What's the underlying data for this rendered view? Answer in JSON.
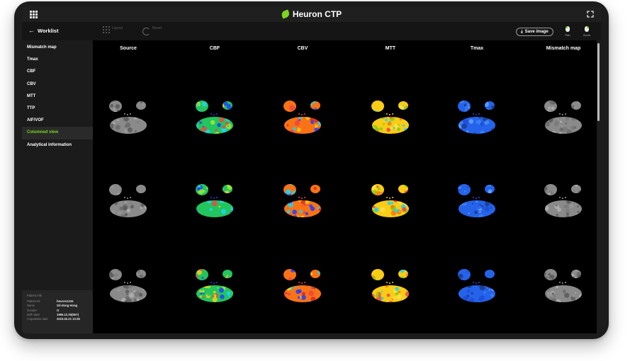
{
  "app": {
    "title": "Heuron CTP",
    "brand_color": "#7bd61f"
  },
  "toolbar": {
    "back_label": "Worklist",
    "layout_label": "Layout",
    "reset_label": "Reset",
    "save_label": "Save image",
    "pan_label": "Pan",
    "zoom_label": "Zoom"
  },
  "sidebar": {
    "items": [
      {
        "label": "Mismatch map",
        "active": false
      },
      {
        "label": "Tmax",
        "active": false
      },
      {
        "label": "CBF",
        "active": false
      },
      {
        "label": "CBV",
        "active": false
      },
      {
        "label": "MTT",
        "active": false
      },
      {
        "label": "TTP",
        "active": false
      },
      {
        "label": "AIF/VOF",
        "active": false
      },
      {
        "label": "Columned view",
        "active": true
      },
      {
        "label": "Analytical information",
        "active": false
      }
    ]
  },
  "patient": {
    "title": "Patient Info",
    "rows": [
      {
        "key": "Patient ID",
        "value": "heuron1234"
      },
      {
        "key": "Name",
        "value": "Gil-dong Hong"
      },
      {
        "key": "Gender",
        "value": "O"
      },
      {
        "key": "Birth date",
        "value": "1966.12.25(56Y)"
      },
      {
        "key": "Acquisition date",
        "value": "2023.02.21 13:35"
      }
    ]
  },
  "columns": [
    {
      "label": "Source",
      "colormap": "gray"
    },
    {
      "label": "CBF",
      "colormap": "rainbow"
    },
    {
      "label": "CBV",
      "colormap": "rainbow-red"
    },
    {
      "label": "MTT",
      "colormap": "rainbow-yellow"
    },
    {
      "label": "Tmax",
      "colormap": "blue"
    },
    {
      "label": "Mismatch map",
      "colormap": "gray-overlay"
    }
  ],
  "rows": 3
}
